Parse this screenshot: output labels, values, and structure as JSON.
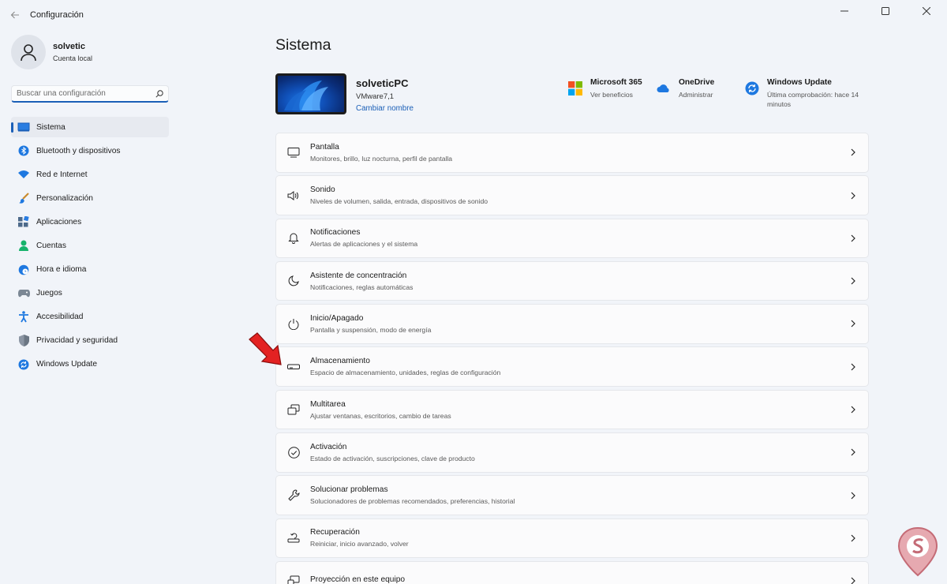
{
  "window": {
    "title": "Configuración"
  },
  "profile": {
    "name": "solvetic",
    "account": "Cuenta local"
  },
  "search": {
    "placeholder": "Buscar una configuración"
  },
  "sidebar": {
    "items": [
      {
        "label": "Sistema",
        "icon": "system-icon",
        "active": true
      },
      {
        "label": "Bluetooth y dispositivos",
        "icon": "bluetooth-icon"
      },
      {
        "label": "Red e Internet",
        "icon": "wifi-icon"
      },
      {
        "label": "Personalización",
        "icon": "brush-icon"
      },
      {
        "label": "Aplicaciones",
        "icon": "apps-icon"
      },
      {
        "label": "Cuentas",
        "icon": "person-icon"
      },
      {
        "label": "Hora e idioma",
        "icon": "globe-clock-icon"
      },
      {
        "label": "Juegos",
        "icon": "gamepad-icon"
      },
      {
        "label": "Accesibilidad",
        "icon": "accessibility-icon"
      },
      {
        "label": "Privacidad y seguridad",
        "icon": "shield-icon"
      },
      {
        "label": "Windows Update",
        "icon": "update-icon"
      }
    ]
  },
  "main": {
    "title": "Sistema",
    "device": {
      "name": "solveticPC",
      "model": "VMware7,1",
      "rename": "Cambiar nombre"
    },
    "quick_links": [
      {
        "title": "Microsoft 365",
        "sub": "Ver beneficios",
        "icon": "microsoft-logo-icon"
      },
      {
        "title": "OneDrive",
        "sub": "Administrar",
        "icon": "cloud-icon"
      },
      {
        "title": "Windows Update",
        "sub": "Última comprobación: hace 14 minutos",
        "icon": "update-icon"
      }
    ],
    "settings": [
      {
        "title": "Pantalla",
        "desc": "Monitores, brillo, luz nocturna, perfil de pantalla",
        "icon": "monitor-icon"
      },
      {
        "title": "Sonido",
        "desc": "Niveles de volumen, salida, entrada, dispositivos de sonido",
        "icon": "speaker-icon"
      },
      {
        "title": "Notificaciones",
        "desc": "Alertas de aplicaciones y el sistema",
        "icon": "bell-icon"
      },
      {
        "title": "Asistente de concentración",
        "desc": "Notificaciones, reglas automáticas",
        "icon": "moon-icon"
      },
      {
        "title": "Inicio/Apagado",
        "desc": "Pantalla y suspensión, modo de energía",
        "icon": "power-icon"
      },
      {
        "title": "Almacenamiento",
        "desc": "Espacio de almacenamiento, unidades, reglas de configuración",
        "icon": "storage-drive-icon"
      },
      {
        "title": "Multitarea",
        "desc": "Ajustar ventanas, escritorios, cambio de tareas",
        "icon": "multitask-icon"
      },
      {
        "title": "Activación",
        "desc": "Estado de activación, suscripciones, clave de producto",
        "icon": "check-circle-icon"
      },
      {
        "title": "Solucionar problemas",
        "desc": "Solucionadores de problemas recomendados, preferencias, historial",
        "icon": "wrench-icon"
      },
      {
        "title": "Recuperación",
        "desc": "Reiniciar, inicio avanzado, volver",
        "icon": "recovery-icon"
      },
      {
        "title": "Proyección en este equipo",
        "desc": "",
        "icon": "projection-icon"
      }
    ]
  },
  "colors": {
    "accent": "#1b5fb7",
    "pointer": "#e32222",
    "background": "#f1f4f9"
  }
}
